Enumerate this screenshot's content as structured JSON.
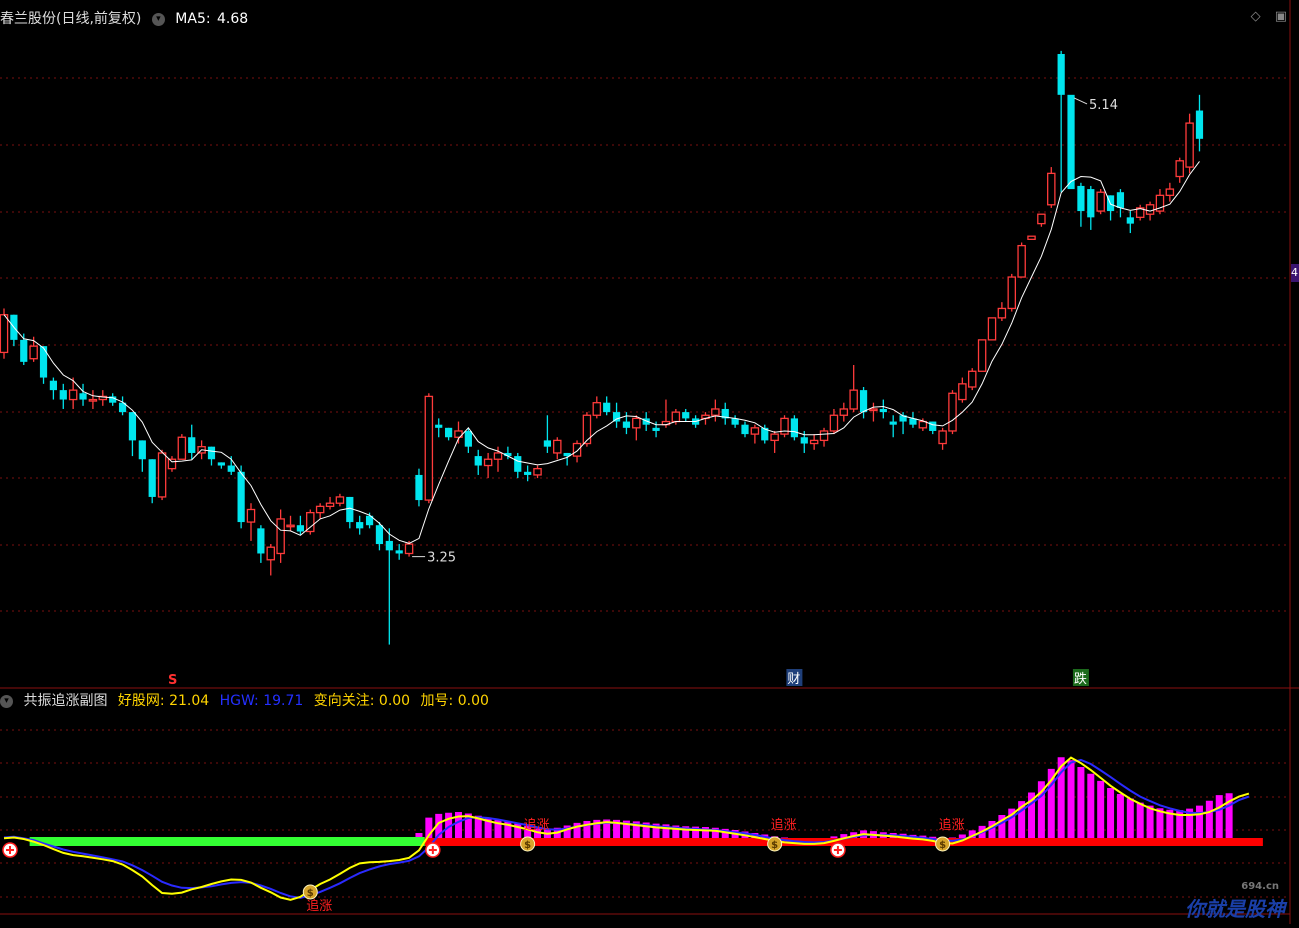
{
  "header": {
    "title": "春兰股份(日线,前复权)",
    "ma_label": "MA5:",
    "ma_value": "4.68"
  },
  "sub_header": {
    "title": "共振追涨副图",
    "items": [
      {
        "label": "好股网:",
        "value": "21.04",
        "color": "#ffd400"
      },
      {
        "label": "HGW:",
        "value": "19.71",
        "color": "#2430ff"
      },
      {
        "label": "变向关注:",
        "value": "0.00",
        "color": "#ffd400"
      },
      {
        "label": "加号:",
        "value": "0.00",
        "color": "#ffd400"
      }
    ]
  },
  "watermark": {
    "text": "你就是股神",
    "sub": "694.cn"
  },
  "colors": {
    "up": "#ff3b3b",
    "down": "#00e5ee",
    "ma": "#ffffff",
    "grid": "#7a1010",
    "magenta": "#ff00ff",
    "green": "#33ff33",
    "yellow": "#ffff00",
    "blue": "#2a2aff"
  },
  "chart_data": [
    {
      "type": "candlestick",
      "title": "春兰股份(日线,前复权)",
      "ylim": [
        3.15,
        5.2
      ],
      "grid": true,
      "annotations": {
        "high": {
          "label": "5.14",
          "index": 108
        },
        "low": {
          "label": "3.25",
          "index": 41
        },
        "markers": [
          {
            "label": "S",
            "index": 17,
            "color": "#ff3030"
          },
          {
            "label": "财",
            "index": 80,
            "color": "#ffffff"
          },
          {
            "label": "跌",
            "index": 109,
            "color": "#ffffff"
          }
        ]
      },
      "candles": [
        [
          4.18,
          4.32,
          4.16,
          4.3
        ],
        [
          4.3,
          4.3,
          4.2,
          4.22
        ],
        [
          4.22,
          4.24,
          4.14,
          4.15
        ],
        [
          4.16,
          4.23,
          4.15,
          4.2
        ],
        [
          4.2,
          4.2,
          4.08,
          4.1
        ],
        [
          4.09,
          4.1,
          4.03,
          4.06
        ],
        [
          4.06,
          4.08,
          4.0,
          4.03
        ],
        [
          4.03,
          4.1,
          4.0,
          4.06
        ],
        [
          4.05,
          4.08,
          4.01,
          4.03
        ],
        [
          4.03,
          4.06,
          4.0,
          4.03
        ],
        [
          4.03,
          4.06,
          4.01,
          4.04
        ],
        [
          4.04,
          4.05,
          4.01,
          4.02
        ],
        [
          4.02,
          4.04,
          3.98,
          3.99
        ],
        [
          3.99,
          3.99,
          3.85,
          3.9
        ],
        [
          3.9,
          3.9,
          3.8,
          3.84
        ],
        [
          3.84,
          3.84,
          3.7,
          3.72
        ],
        [
          3.72,
          3.87,
          3.71,
          3.86
        ],
        [
          3.81,
          3.85,
          3.8,
          3.84
        ],
        [
          3.84,
          3.92,
          3.84,
          3.91
        ],
        [
          3.91,
          3.95,
          3.84,
          3.86
        ],
        [
          3.86,
          3.9,
          3.84,
          3.88
        ],
        [
          3.88,
          3.88,
          3.82,
          3.84
        ],
        [
          3.83,
          3.83,
          3.81,
          3.82
        ],
        [
          3.82,
          3.85,
          3.79,
          3.8
        ],
        [
          3.8,
          3.82,
          3.62,
          3.64
        ],
        [
          3.64,
          3.7,
          3.58,
          3.68
        ],
        [
          3.62,
          3.63,
          3.51,
          3.54
        ],
        [
          3.52,
          3.57,
          3.47,
          3.56
        ],
        [
          3.54,
          3.68,
          3.51,
          3.65
        ],
        [
          3.63,
          3.66,
          3.61,
          3.63
        ],
        [
          3.63,
          3.66,
          3.6,
          3.61
        ],
        [
          3.61,
          3.68,
          3.6,
          3.67
        ],
        [
          3.67,
          3.7,
          3.65,
          3.69
        ],
        [
          3.69,
          3.72,
          3.68,
          3.7
        ],
        [
          3.7,
          3.73,
          3.69,
          3.72
        ],
        [
          3.72,
          3.72,
          3.62,
          3.64
        ],
        [
          3.64,
          3.66,
          3.6,
          3.62
        ],
        [
          3.66,
          3.67,
          3.62,
          3.63
        ],
        [
          3.63,
          3.64,
          3.55,
          3.57
        ],
        [
          3.58,
          3.62,
          3.25,
          3.55
        ],
        [
          3.55,
          3.57,
          3.52,
          3.54
        ],
        [
          3.54,
          3.58,
          3.53,
          3.57
        ],
        [
          3.79,
          3.81,
          3.69,
          3.71
        ],
        [
          3.71,
          4.05,
          3.7,
          4.04
        ],
        [
          3.95,
          3.97,
          3.91,
          3.94
        ],
        [
          3.94,
          3.94,
          3.9,
          3.91
        ],
        [
          3.91,
          3.96,
          3.89,
          3.93
        ],
        [
          3.93,
          3.94,
          3.86,
          3.88
        ],
        [
          3.85,
          3.87,
          3.79,
          3.82
        ],
        [
          3.82,
          3.86,
          3.78,
          3.84
        ],
        [
          3.84,
          3.88,
          3.8,
          3.86
        ],
        [
          3.86,
          3.88,
          3.84,
          3.85
        ],
        [
          3.85,
          3.86,
          3.78,
          3.8
        ],
        [
          3.8,
          3.82,
          3.77,
          3.79
        ],
        [
          3.79,
          3.82,
          3.78,
          3.81
        ],
        [
          3.9,
          3.98,
          3.86,
          3.88
        ],
        [
          3.86,
          3.91,
          3.84,
          3.9
        ],
        [
          3.86,
          3.86,
          3.82,
          3.85
        ],
        [
          3.85,
          3.9,
          3.83,
          3.89
        ],
        [
          3.89,
          3.99,
          3.88,
          3.98
        ],
        [
          3.98,
          4.04,
          3.97,
          4.02
        ],
        [
          4.02,
          4.04,
          3.98,
          3.99
        ],
        [
          3.99,
          4.02,
          3.94,
          3.96
        ],
        [
          3.96,
          3.99,
          3.92,
          3.94
        ],
        [
          3.94,
          3.98,
          3.9,
          3.97
        ],
        [
          3.97,
          3.99,
          3.93,
          3.95
        ],
        [
          3.94,
          3.96,
          3.91,
          3.93
        ],
        [
          3.95,
          4.03,
          3.94,
          3.96
        ],
        [
          3.96,
          4.0,
          3.95,
          3.99
        ],
        [
          3.99,
          4.0,
          3.96,
          3.97
        ],
        [
          3.97,
          3.98,
          3.94,
          3.95
        ],
        [
          3.97,
          3.99,
          3.95,
          3.98
        ],
        [
          3.98,
          4.03,
          3.96,
          4.0
        ],
        [
          4.0,
          4.02,
          3.95,
          3.97
        ],
        [
          3.97,
          3.98,
          3.94,
          3.95
        ],
        [
          3.95,
          3.96,
          3.91,
          3.92
        ],
        [
          3.92,
          3.95,
          3.89,
          3.94
        ],
        [
          3.94,
          3.95,
          3.89,
          3.9
        ],
        [
          3.9,
          3.93,
          3.86,
          3.92
        ],
        [
          3.92,
          3.98,
          3.91,
          3.97
        ],
        [
          3.97,
          3.98,
          3.9,
          3.91
        ],
        [
          3.91,
          3.93,
          3.86,
          3.89
        ],
        [
          3.89,
          3.92,
          3.87,
          3.9
        ],
        [
          3.9,
          3.94,
          3.88,
          3.93
        ],
        [
          3.93,
          4.0,
          3.92,
          3.98
        ],
        [
          3.98,
          4.02,
          3.96,
          4.0
        ],
        [
          4.0,
          4.14,
          3.99,
          4.06
        ],
        [
          4.06,
          4.07,
          3.97,
          3.99
        ],
        [
          4.0,
          4.02,
          3.96,
          4.0
        ],
        [
          4.0,
          4.03,
          3.97,
          3.99
        ],
        [
          3.96,
          3.98,
          3.91,
          3.95
        ],
        [
          3.98,
          3.99,
          3.92,
          3.96
        ],
        [
          3.97,
          3.99,
          3.94,
          3.95
        ],
        [
          3.94,
          3.97,
          3.93,
          3.96
        ],
        [
          3.96,
          3.96,
          3.92,
          3.93
        ],
        [
          3.89,
          3.94,
          3.87,
          3.93
        ],
        [
          3.93,
          4.06,
          3.92,
          4.05
        ],
        [
          4.03,
          4.1,
          4.02,
          4.08
        ],
        [
          4.07,
          4.13,
          4.06,
          4.12
        ],
        [
          4.12,
          4.22,
          4.12,
          4.22
        ],
        [
          4.22,
          4.29,
          4.22,
          4.29
        ],
        [
          4.29,
          4.34,
          4.28,
          4.32
        ],
        [
          4.32,
          4.43,
          4.31,
          4.42
        ],
        [
          4.42,
          4.53,
          4.42,
          4.52
        ],
        [
          4.54,
          4.55,
          4.54,
          4.55
        ],
        [
          4.59,
          4.62,
          4.58,
          4.62
        ],
        [
          4.65,
          4.77,
          4.64,
          4.75
        ],
        [
          5.13,
          5.14,
          4.69,
          5.0
        ],
        [
          5.0,
          4.99,
          4.71,
          4.7
        ],
        [
          4.71,
          4.72,
          4.58,
          4.63
        ],
        [
          4.7,
          4.71,
          4.57,
          4.61
        ],
        [
          4.63,
          4.7,
          4.62,
          4.69
        ],
        [
          4.68,
          4.68,
          4.6,
          4.63
        ],
        [
          4.69,
          4.7,
          4.61,
          4.64
        ],
        [
          4.61,
          4.63,
          4.56,
          4.59
        ],
        [
          4.61,
          4.65,
          4.6,
          4.64
        ],
        [
          4.62,
          4.66,
          4.6,
          4.65
        ],
        [
          4.63,
          4.7,
          4.62,
          4.68
        ],
        [
          4.68,
          4.72,
          4.66,
          4.7
        ],
        [
          4.74,
          4.8,
          4.72,
          4.79
        ],
        [
          4.77,
          4.94,
          4.75,
          4.91
        ],
        [
          4.95,
          5.0,
          4.82,
          4.86
        ]
      ],
      "ma5_label": "MA5",
      "ma5_value": 4.68
    },
    {
      "type": "indicator",
      "title": "共振追涨副图",
      "ylim": [
        -10,
        30
      ],
      "series": [
        {
          "name": "好股网",
          "color": "#ffff00",
          "values": [
            1,
            1.2,
            0.8,
            0.1,
            -0.8,
            -1.9,
            -2.9,
            -3.5,
            -3.8,
            -4.2,
            -4.6,
            -5.1,
            -6,
            -7.5,
            -9.2,
            -11.5,
            -13.6,
            -13.8,
            -13.5,
            -12.6,
            -12,
            -11.2,
            -10.5,
            -10,
            -10.1,
            -10.8,
            -12.2,
            -13.4,
            -14.8,
            -15.4,
            -14.6,
            -12.8,
            -11.2,
            -10,
            -8.5,
            -6.9,
            -5.7,
            -5.4,
            -5.3,
            -5.1,
            -4.8,
            -4.2,
            -2.2,
            1.8,
            5.1,
            6.2,
            6.8,
            6.9,
            6.3,
            5.6,
            5,
            4.6,
            4,
            3.4,
            2.6,
            2.2,
            2.5,
            3.4,
            4.1,
            4.6,
            5,
            5.3,
            5.1,
            4.8,
            4.5,
            4.2,
            3.9,
            3.7,
            3.5,
            3.3,
            3.2,
            3.1,
            3,
            2.6,
            2.2,
            1.8,
            1.3,
            0.8,
            0.3,
            -0.1,
            -0.3,
            -0.5,
            -0.5,
            -0.3,
            0.3,
            1,
            1.6,
            2.1,
            1.9,
            1.7,
            1.5,
            1.2,
            0.9,
            0.7,
            0.3,
            -0.3,
            -0.4,
            0.4,
            1.6,
            2.8,
            4.2,
            5.8,
            7.3,
            9.4,
            11.1,
            13.4,
            16.5,
            20.2,
            22.5,
            21.04,
            19.2,
            17.1,
            15,
            13.2,
            11.5,
            10.2,
            9,
            8.2,
            7.6,
            7.2,
            7.2,
            7.4,
            8,
            9.2,
            10.8,
            12.1,
            12.9
          ]
        },
        {
          "name": "HGW",
          "color": "#2a2aff",
          "values": [
            1.2,
            1.4,
            1,
            0.5,
            -0.4,
            -1.2,
            -2,
            -2.6,
            -3.1,
            -3.6,
            -4.1,
            -4.6,
            -5.2,
            -6.2,
            -7.5,
            -9,
            -10.6,
            -11.6,
            -12.2,
            -12.3,
            -12.1,
            -11.8,
            -11.3,
            -10.9,
            -10.7,
            -10.9,
            -11.6,
            -12.5,
            -13.6,
            -14.5,
            -14.9,
            -14.2,
            -13.3,
            -12.2,
            -11,
            -9.6,
            -8.3,
            -7.3,
            -6.5,
            -5.9,
            -5.5,
            -5,
            -3.8,
            -1.4,
            1.9,
            4,
            5.4,
            6.4,
            6.6,
            6.4,
            6,
            5.5,
            5,
            4.5,
            3.9,
            3.4,
            3.3,
            3.6,
            4.1,
            4.5,
            4.9,
            5.1,
            5.1,
            4.9,
            4.7,
            4.5,
            4.2,
            4,
            3.8,
            3.6,
            3.5,
            3.3,
            3.2,
            2.9,
            2.6,
            2.3,
            1.9,
            1.4,
            0.9,
            0.5,
            0.2,
            0,
            -0.1,
            0,
            0.4,
            0.9,
            1.4,
            1.8,
            1.9,
            1.9,
            1.8,
            1.6,
            1.4,
            1.1,
            0.8,
            0.4,
            0.3,
            0.7,
            1.5,
            2.6,
            3.8,
            5.1,
            6.6,
            8.4,
            10.3,
            12.3,
            15.2,
            18.6,
            21.2,
            21.9,
            20.8,
            19.1,
            17.3,
            15.5,
            13.7,
            12.1,
            10.9,
            9.8,
            9,
            8.3,
            7.8,
            7.7,
            8,
            8.6,
            9.7,
            11.2,
            12.1
          ]
        },
        {
          "name": "柱",
          "color": "#ff00ff",
          "values": [
            0,
            0,
            0,
            0,
            0,
            0,
            0,
            0,
            0,
            0,
            0,
            0,
            0,
            0,
            0,
            0,
            0,
            0,
            0,
            0,
            0,
            0,
            0,
            0,
            0,
            0,
            0,
            0,
            0,
            0,
            0,
            0,
            0,
            0,
            0,
            0,
            0,
            0,
            0,
            0,
            0,
            0,
            2.4,
            6.5,
            7.5,
            7.8,
            8,
            7.6,
            7,
            6.4,
            5.9,
            5.5,
            4.9,
            4.3,
            3.6,
            3.3,
            3.8,
            4.4,
            5.1,
            5.6,
            5.9,
            6,
            5.9,
            5.7,
            5.5,
            5.2,
            4.9,
            4.7,
            4.4,
            4.2,
            4.1,
            4,
            3.8,
            3.5,
            3.2,
            2.8,
            2.4,
            2,
            1.5,
            1.2,
            1,
            0.8,
            0.8,
            1,
            1.5,
            2.1,
            2.6,
            3.1,
            2.9,
            2.6,
            2.4,
            2.2,
            1.9,
            1.7,
            1.4,
            1,
            1.2,
            2,
            3.1,
            4.3,
            5.6,
            7.2,
            8.9,
            10.9,
            13.2,
            16.2,
            19.5,
            22.6,
            21.8,
            20,
            18.2,
            16.3,
            14.4,
            12.8,
            11.6,
            10.5,
            9.7,
            9,
            8.6,
            8.5,
            8.9,
            9.7,
            11,
            12.5,
            13
          ]
        }
      ],
      "bands": [
        {
          "name": "绿带",
          "color": "#33ff33",
          "from": 3,
          "to": 43
        },
        {
          "name": "红带",
          "color": "#ff0000",
          "from": 43,
          "to": 126
        }
      ],
      "signals": [
        {
          "label": "追涨",
          "index": 31
        },
        {
          "label": "追涨",
          "index": 53
        },
        {
          "label": "追涨",
          "index": 78
        },
        {
          "label": "追涨",
          "index": 95
        }
      ],
      "plus_markers": [
        0,
        43,
        84
      ]
    }
  ]
}
